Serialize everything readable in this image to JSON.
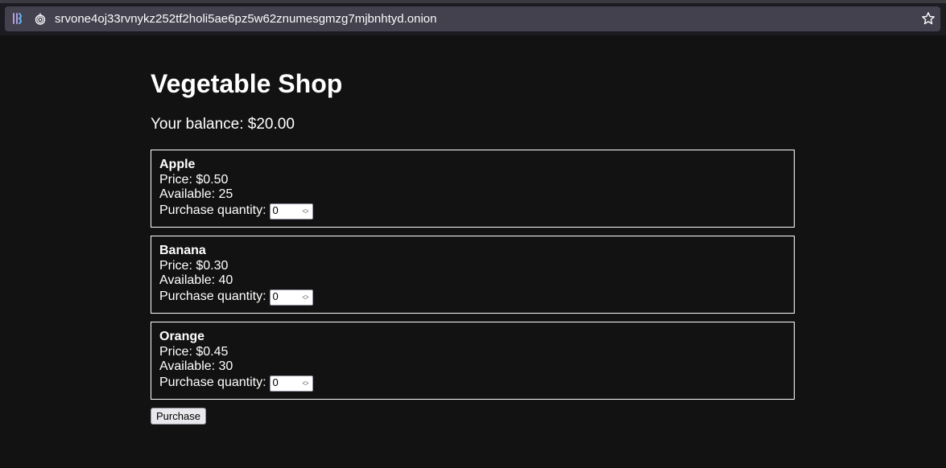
{
  "browser": {
    "url": "srvone4oj33rvnykz252tf2holi5ae6pz5w62znumesgmzg7mjbnhtyd.onion",
    "icons": [
      "tor-circuit-icon",
      "onion-icon",
      "bookmark-star-icon"
    ]
  },
  "page": {
    "title": "Vegetable Shop",
    "balance_label": "Your balance: $20.00"
  },
  "products": [
    {
      "name": "Apple",
      "price": "Price: $0.50",
      "available": "Available: 25",
      "qty_label": "Purchase quantity:",
      "qty": "0"
    },
    {
      "name": "Banana",
      "price": "Price: $0.30",
      "available": "Available: 40",
      "qty_label": "Purchase quantity:",
      "qty": "0"
    },
    {
      "name": "Orange",
      "price": "Price: $0.45",
      "available": "Available: 30",
      "qty_label": "Purchase quantity:",
      "qty": "0"
    }
  ],
  "actions": {
    "purchase_label": "Purchase"
  },
  "colors": {
    "background": "#121212",
    "text": "#ffffff",
    "url_bar": "#42414d"
  }
}
